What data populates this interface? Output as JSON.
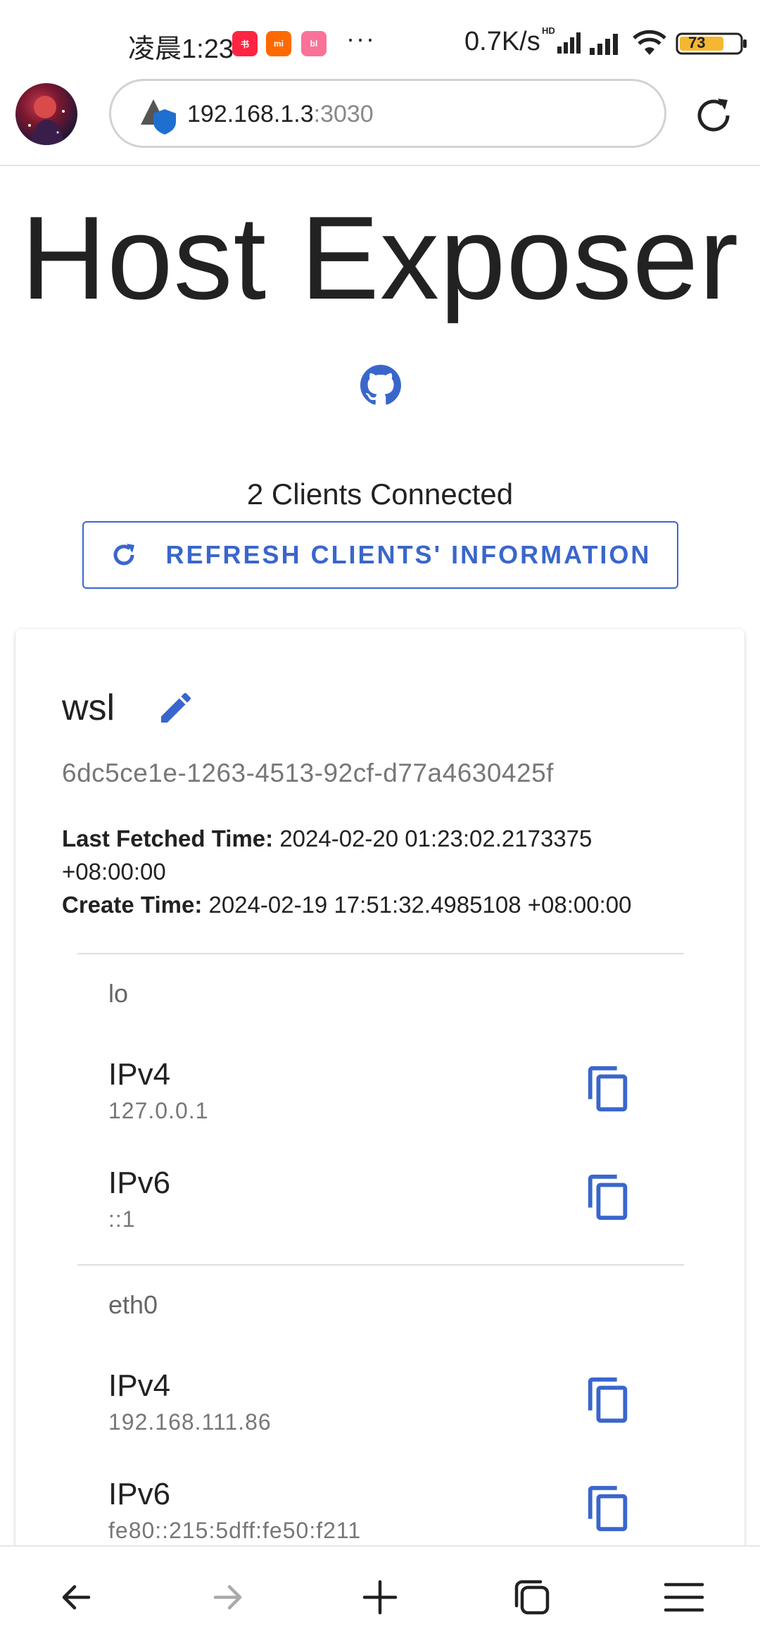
{
  "status_bar": {
    "time": "凌晨1:23",
    "apps": [
      {
        "name": "xiaohongshu",
        "label": "小红书",
        "color": "#ff2442"
      },
      {
        "name": "mi-store",
        "label": "mi",
        "color": "#ff6a00"
      },
      {
        "name": "bilibili",
        "label": "bili",
        "color": "#fb7299"
      }
    ],
    "more": "···",
    "net_speed": "0.7K/s",
    "network_badge": "HD",
    "battery": "73",
    "battery_color": "#f5b731"
  },
  "browser": {
    "url_host": "192.168.1.3",
    "url_port": ":3030",
    "security_icon": "shield-warning-icon",
    "reload_icon": "reload-icon"
  },
  "page": {
    "title": "Host Exposer",
    "github_icon": "github-icon",
    "clients_count": "2 Clients Connected",
    "refresh_label": "REFRESH CLIENTS' INFORMATION",
    "accent_color": "#3a66cc"
  },
  "client": {
    "name": "wsl",
    "id": "6dc5ce1e-1263-4513-92cf-d77a4630425f",
    "last_fetched_label": "Last Fetched Time:",
    "last_fetched_value": "2024-02-20 01:23:02.2173375",
    "last_fetched_tz": "+08:00:00",
    "create_label": "Create Time:",
    "create_value": "2024-02-19 17:51:32.4985108 +08:00:00",
    "interfaces": [
      {
        "name": "lo",
        "addresses": [
          {
            "type": "IPv4",
            "value": "127.0.0.1"
          },
          {
            "type": "IPv6",
            "value": "::1"
          }
        ]
      },
      {
        "name": "eth0",
        "addresses": [
          {
            "type": "IPv4",
            "value": "192.168.111.86"
          },
          {
            "type": "IPv6",
            "value": "fe80::215:5dff:fe50:f211"
          }
        ]
      }
    ]
  },
  "bottom_nav": {
    "items": [
      "back-icon",
      "forward-icon",
      "new-tab-icon",
      "tabs-icon",
      "menu-icon"
    ]
  }
}
